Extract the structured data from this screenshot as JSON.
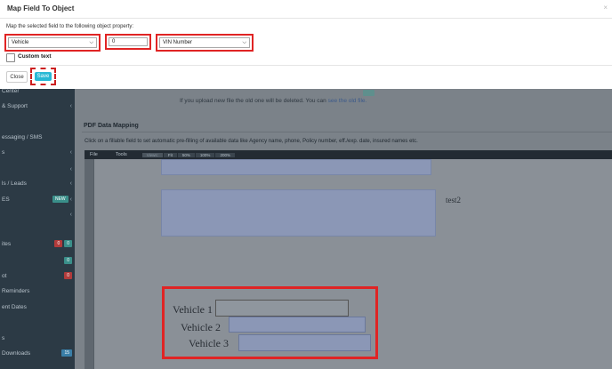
{
  "modal": {
    "title": "Map Field To Object",
    "close_icon": "×",
    "description": "Map the selected field to the following object property:",
    "object_select": {
      "value": "Vehicle"
    },
    "index_input": {
      "value": "0"
    },
    "property_select": {
      "value": "VIN Number"
    },
    "custom_text_label": "Custom text",
    "close_button": "Close",
    "save_button": "Save"
  },
  "sidebar": {
    "items": [
      {
        "label": "Center",
        "chevron": ""
      },
      {
        "label": "& Support",
        "chevron": "‹"
      },
      {
        "label": "essaging / SMS",
        "chevron": ""
      },
      {
        "label": "s",
        "chevron": "‹"
      },
      {
        "label": "",
        "chevron": "‹"
      },
      {
        "label": "ls / Leads",
        "chevron": "‹"
      },
      {
        "label": "ES",
        "chevron": "‹",
        "badge": "NEW"
      },
      {
        "label": "",
        "chevron": "‹"
      },
      {
        "label": "ites",
        "chevron": "",
        "badges": [
          "0",
          "0"
        ]
      },
      {
        "label": "",
        "chevron": "",
        "badges": [
          "0"
        ]
      },
      {
        "label": "ot",
        "chevron": "",
        "badges": [
          "0"
        ]
      },
      {
        "label": "Reminders",
        "chevron": ""
      },
      {
        "label": "ent Dates",
        "chevron": ""
      },
      {
        "label": "s",
        "chevron": ""
      },
      {
        "label": "Downloads",
        "chevron": "",
        "badges": [
          "15"
        ]
      },
      {
        "label": "",
        "chevron": ""
      }
    ]
  },
  "main": {
    "notice_text": "If you upload new file the old one will be deleted. You can ",
    "notice_link": "see the old file.",
    "pdf_title": "PDF Data Mapping",
    "pdf_description": "Click on a fillable field to set automatic pre-filling of available data like Agency name, phone, Policy number, eff./exp. date, insured names etc.",
    "toolbar": {
      "file": "File",
      "tools": "Tools",
      "views": "Views:",
      "zoom_options": [
        "Fit",
        "50%",
        "100%",
        "200%"
      ]
    },
    "page": {
      "test_label": "test2",
      "vehicle_labels": [
        "Vehicle 1",
        "Vehicle 2",
        "Vehicle 3"
      ]
    }
  },
  "colors": {
    "accent": "#28b9d5",
    "highlight": "#e02424",
    "field_fill": "#8b97b6",
    "sidebar_bg": "#2c3a45"
  }
}
